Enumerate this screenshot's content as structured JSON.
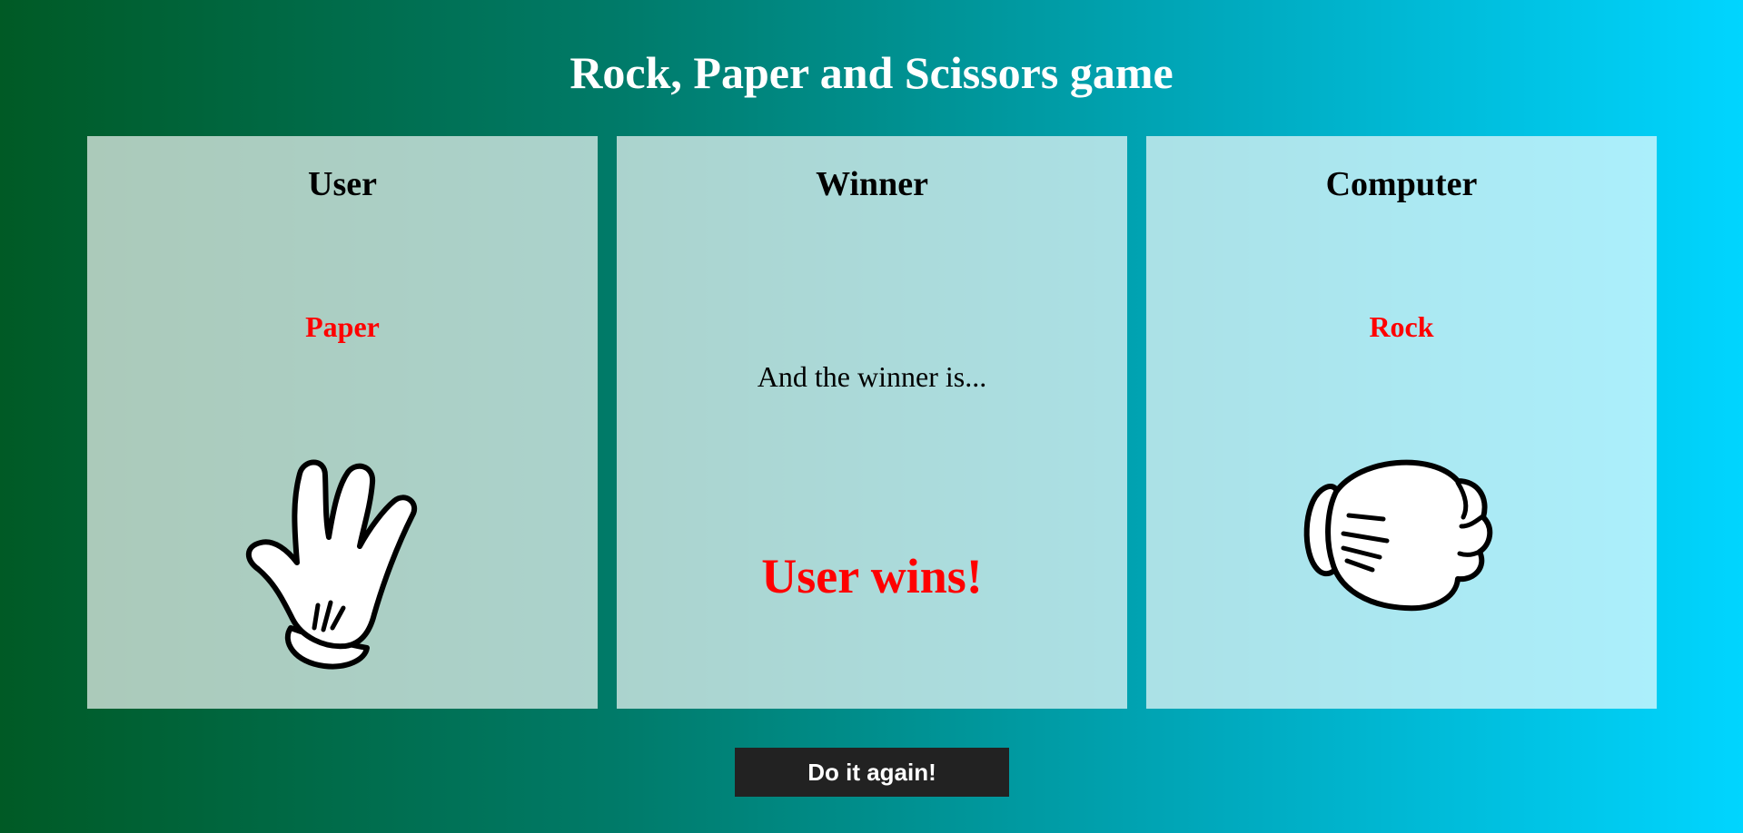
{
  "page": {
    "title": "Rock, Paper and Scissors game"
  },
  "user_panel": {
    "heading": "User",
    "choice": "Paper",
    "hand_icon": "paper-hand-icon"
  },
  "winner_panel": {
    "heading": "Winner",
    "intro": "And the winner is...",
    "result": "User wins!"
  },
  "computer_panel": {
    "heading": "Computer",
    "choice": "Rock",
    "hand_icon": "rock-fist-icon"
  },
  "actions": {
    "again_label": "Do it again!"
  },
  "colors": {
    "accent_red": "#ff0000",
    "button_bg": "#222222",
    "gradient_start": "#005a25",
    "gradient_end": "#00d5ff"
  }
}
